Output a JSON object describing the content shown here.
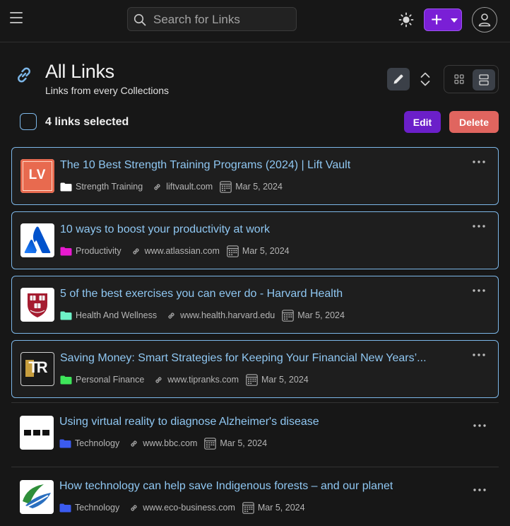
{
  "header": {
    "search_placeholder": "Search for Links"
  },
  "page": {
    "title": "All Links",
    "subtitle": "Links from every Collections"
  },
  "selection": {
    "count_text": "4 links selected",
    "edit_label": "Edit",
    "delete_label": "Delete"
  },
  "colors": {
    "accent": "#7a1fd6",
    "link_title": "#8fc7f2",
    "selected_border": "#7db7e8",
    "delete": "#e0655f"
  },
  "links": [
    {
      "title": "The 10 Best Strength Training Programs (2024) | Lift Vault",
      "collection": "Strength Training",
      "collection_color": "#ffffff",
      "domain": "liftvault.com",
      "date": "Mar 5, 2024",
      "selected": true,
      "icon": "liftvault-logo",
      "logo_text": "LV"
    },
    {
      "title": "10 ways to boost your productivity at work",
      "collection": "Productivity",
      "collection_color": "#e81ad0",
      "domain": "www.atlassian.com",
      "date": "Mar 5, 2024",
      "selected": true,
      "icon": "atlassian-logo"
    },
    {
      "title": "5 of the best exercises you can ever do - Harvard Health",
      "collection": "Health And Wellness",
      "collection_color": "#6ef2c8",
      "domain": "www.health.harvard.edu",
      "date": "Mar 5, 2024",
      "selected": true,
      "icon": "harvard-shield-logo"
    },
    {
      "title": "Saving Money: Smart Strategies for Keeping Your Financial New Years’...",
      "collection": "Personal Finance",
      "collection_color": "#3ee65a",
      "domain": "www.tipranks.com",
      "date": "Mar 5, 2024",
      "selected": true,
      "icon": "tipranks-logo",
      "logo_text": "TR"
    },
    {
      "title": "Using virtual reality to diagnose Alzheimer's disease",
      "collection": "Technology",
      "collection_color": "#3b5bf0",
      "domain": "www.bbc.com",
      "date": "Mar 5, 2024",
      "selected": false,
      "icon": "bbc-logo"
    },
    {
      "title": "How technology can help save Indigenous forests – and our planet",
      "collection": "Technology",
      "collection_color": "#3b5bf0",
      "domain": "www.eco-business.com",
      "date": "Mar 5, 2024",
      "selected": false,
      "icon": "eco-business-logo"
    }
  ]
}
